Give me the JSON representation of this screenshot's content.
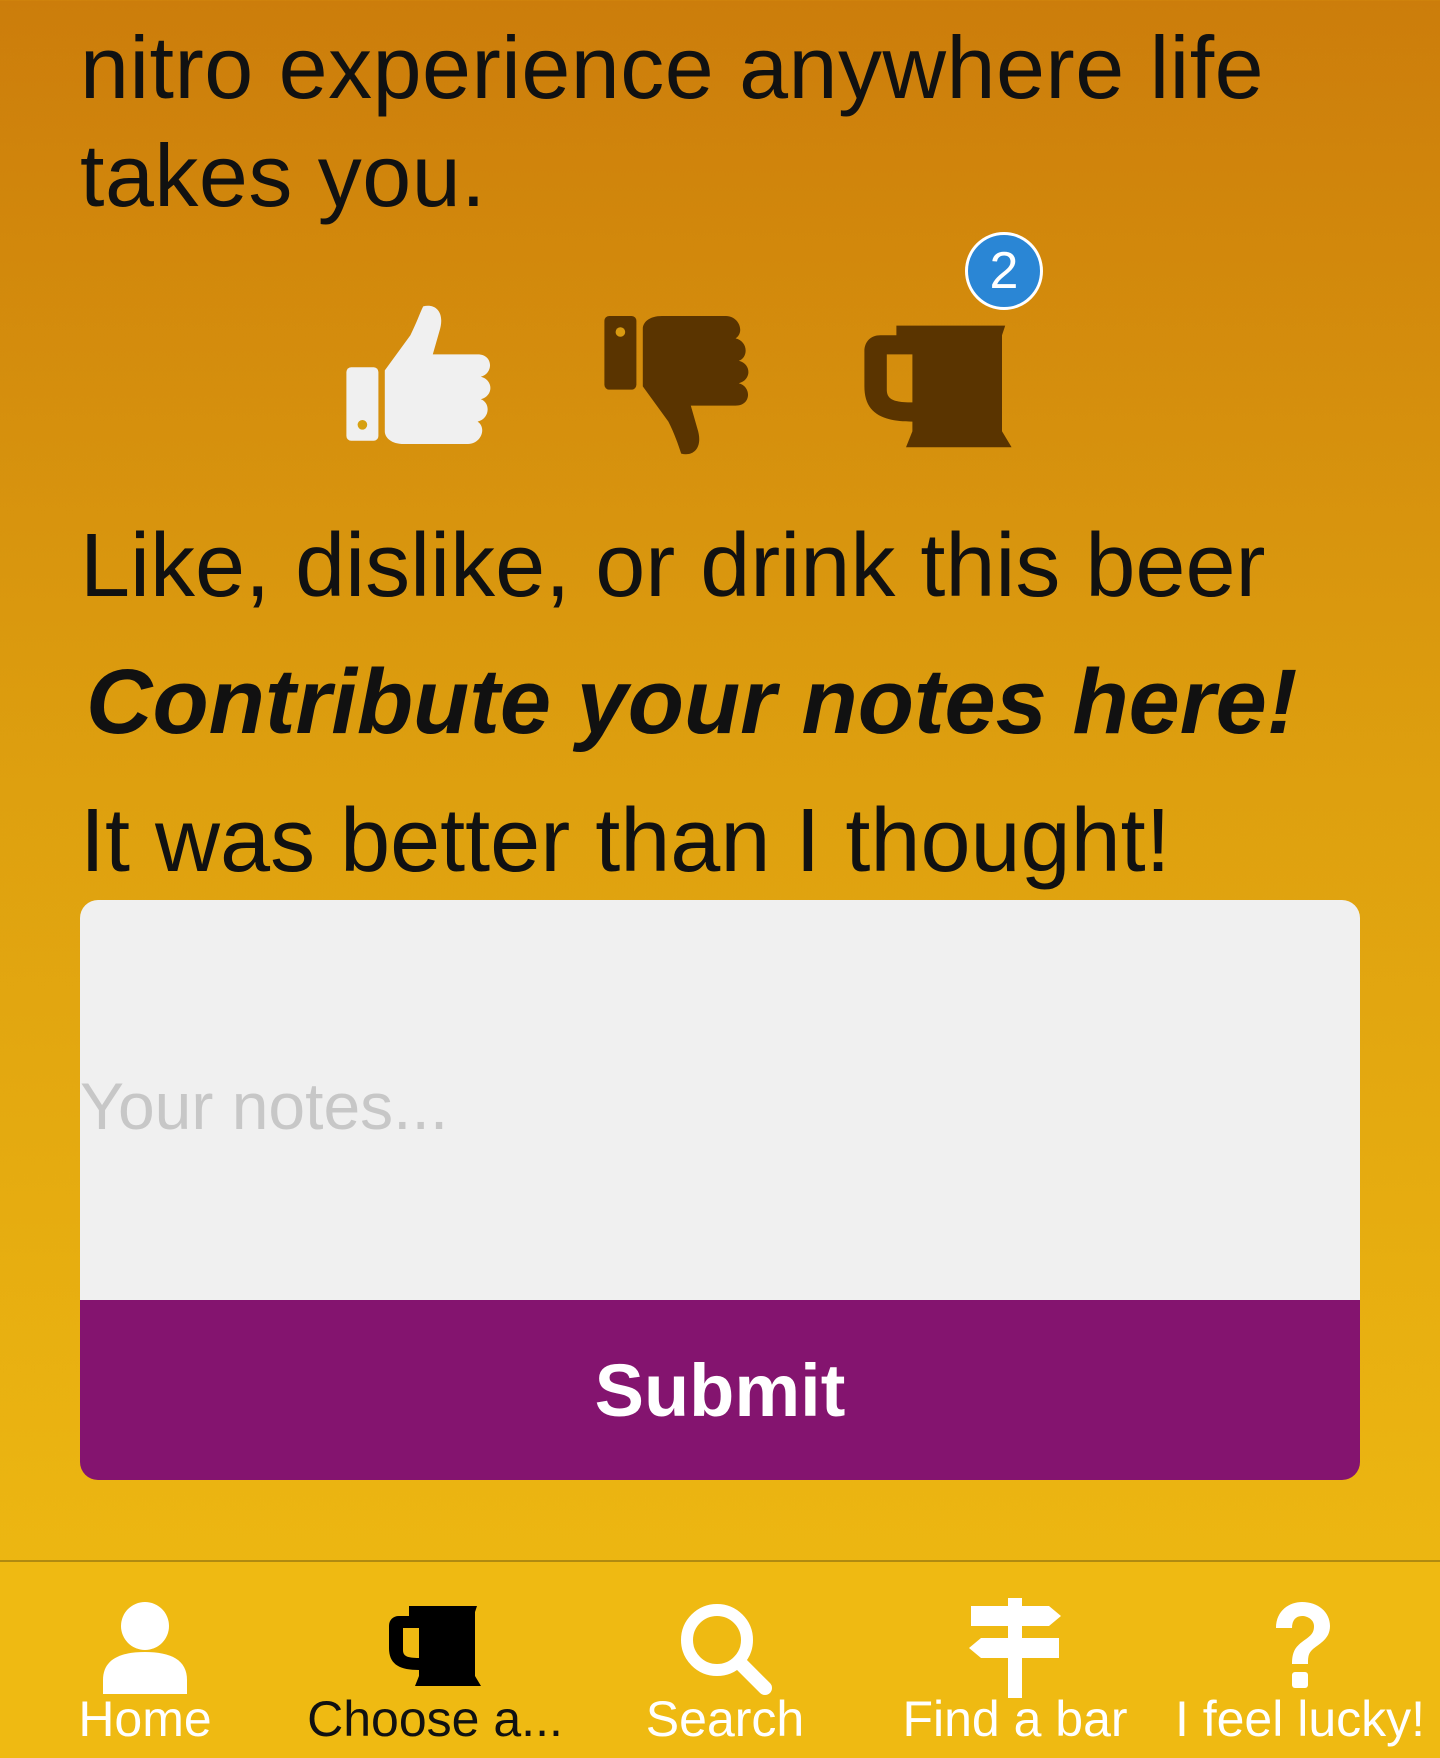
{
  "description": {
    "lines": [
      "nitro experience anywhere life",
      "takes you."
    ]
  },
  "actions": {
    "like_icon": "thumbs-up-icon",
    "dislike_icon": "thumbs-down-icon",
    "drink_icon": "beer-mug-icon",
    "drink_count": "2",
    "like_color": "#f0f0f0",
    "dislike_color": "#5a3400",
    "drink_color": "#5a3400",
    "badge_color": "#2a86d5"
  },
  "prompt": {
    "line1": "Like, dislike, or drink this beer",
    "line2": "Contribute your notes here!",
    "line3": "It was better than I thought!"
  },
  "notes": {
    "placeholder": "Your notes...",
    "value": ""
  },
  "submit": {
    "label": "Submit",
    "color": "#84146f"
  },
  "tabbar": {
    "items": [
      {
        "label": "Home",
        "icon": "user-icon"
      },
      {
        "label": "Choose a...",
        "icon": "beer-mug-icon",
        "active": true
      },
      {
        "label": "Search",
        "icon": "search-icon"
      },
      {
        "label": "Find a bar",
        "icon": "signpost-icon"
      },
      {
        "label": "I feel lucky!",
        "icon": "question-icon"
      }
    ]
  }
}
